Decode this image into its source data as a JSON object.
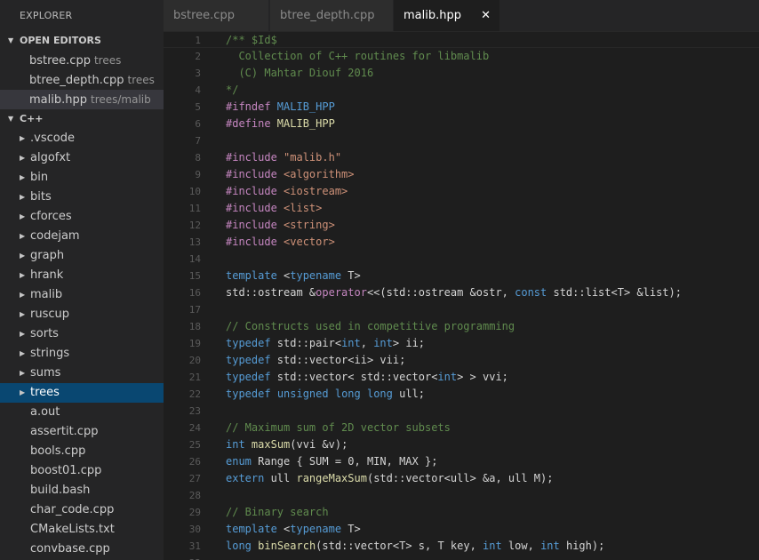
{
  "sidebar": {
    "title": "EXPLORER",
    "open_editors": {
      "header": "OPEN EDITORS",
      "items": [
        {
          "name": "bstree.cpp",
          "desc": "trees"
        },
        {
          "name": "btree_depth.cpp",
          "desc": "trees"
        },
        {
          "name": "malib.hpp",
          "desc": "trees/malib"
        }
      ]
    },
    "workspace": {
      "header": "C++",
      "folders": [
        ".vscode",
        "algofxt",
        "bin",
        "bits",
        "cforces",
        "codejam",
        "graph",
        "hrank",
        "malib",
        "ruscup",
        "sorts",
        "strings",
        "sums",
        "trees"
      ],
      "files": [
        "a.out",
        "assertit.cpp",
        "bools.cpp",
        "boost01.cpp",
        "build.bash",
        "char_code.cpp",
        "CMakeLists.txt",
        "convbase.cpp"
      ]
    }
  },
  "tabs": [
    {
      "label": "bstree.cpp"
    },
    {
      "label": "btree_depth.cpp"
    },
    {
      "label": "malib.hpp",
      "close_glyph": "✕"
    }
  ],
  "editor": {
    "lines": [
      [
        [
          "comment",
          "/** $Id$"
        ]
      ],
      [
        [
          "comment",
          "  Collection of C++ routines for libmalib"
        ]
      ],
      [
        [
          "comment",
          "  (C) Mahtar Diouf 2016"
        ]
      ],
      [
        [
          "comment",
          "*/"
        ]
      ],
      [
        [
          "pp",
          "#ifndef "
        ],
        [
          "macro",
          "MALIB_HPP"
        ]
      ],
      [
        [
          "pp",
          "#define "
        ],
        [
          "fn",
          "MALIB_HPP"
        ]
      ],
      [],
      [
        [
          "pp",
          "#include "
        ],
        [
          "str",
          "\"malib.h\""
        ]
      ],
      [
        [
          "pp",
          "#include "
        ],
        [
          "str",
          "<algorithm>"
        ]
      ],
      [
        [
          "pp",
          "#include "
        ],
        [
          "str",
          "<iostream>"
        ]
      ],
      [
        [
          "pp",
          "#include "
        ],
        [
          "str",
          "<list>"
        ]
      ],
      [
        [
          "pp",
          "#include "
        ],
        [
          "str",
          "<string>"
        ]
      ],
      [
        [
          "pp",
          "#include "
        ],
        [
          "str",
          "<vector>"
        ]
      ],
      [],
      [
        [
          "kw",
          "template"
        ],
        [
          "text",
          " <"
        ],
        [
          "kw",
          "typename"
        ],
        [
          "text",
          " T>"
        ]
      ],
      [
        [
          "text",
          "std::ostream &"
        ],
        [
          "op",
          "operator"
        ],
        [
          "text",
          "<<(std::ostream &ostr, "
        ],
        [
          "kw",
          "const"
        ],
        [
          "text",
          " std::list<T> &list);"
        ]
      ],
      [],
      [
        [
          "comment",
          "// Constructs used in competitive programming"
        ]
      ],
      [
        [
          "kw",
          "typedef"
        ],
        [
          "text",
          " std::pair<"
        ],
        [
          "kw",
          "int"
        ],
        [
          "text",
          ", "
        ],
        [
          "kw",
          "int"
        ],
        [
          "text",
          "> ii;"
        ]
      ],
      [
        [
          "kw",
          "typedef"
        ],
        [
          "text",
          " std::vector<ii> vii;"
        ]
      ],
      [
        [
          "kw",
          "typedef"
        ],
        [
          "text",
          " std::vector< std::vector<"
        ],
        [
          "kw",
          "int"
        ],
        [
          "text",
          "> > vvi;"
        ]
      ],
      [
        [
          "kw",
          "typedef"
        ],
        [
          "text",
          " "
        ],
        [
          "kw",
          "unsigned"
        ],
        [
          "text",
          " "
        ],
        [
          "kw",
          "long"
        ],
        [
          "text",
          " "
        ],
        [
          "kw",
          "long"
        ],
        [
          "text",
          " ull;"
        ]
      ],
      [],
      [
        [
          "comment",
          "// Maximum sum of 2D vector subsets"
        ]
      ],
      [
        [
          "kw",
          "int"
        ],
        [
          "text",
          " "
        ],
        [
          "fn",
          "maxSum"
        ],
        [
          "text",
          "(vvi &v);"
        ]
      ],
      [
        [
          "kw",
          "enum"
        ],
        [
          "text",
          " Range { SUM = 0, MIN, MAX };"
        ]
      ],
      [
        [
          "kw",
          "extern"
        ],
        [
          "text",
          " ull "
        ],
        [
          "fn",
          "rangeMaxSum"
        ],
        [
          "text",
          "(std::vector<ull> &a, ull M);"
        ]
      ],
      [],
      [
        [
          "comment",
          "// Binary search"
        ]
      ],
      [
        [
          "kw",
          "template"
        ],
        [
          "text",
          " <"
        ],
        [
          "kw",
          "typename"
        ],
        [
          "text",
          " T>"
        ]
      ],
      [
        [
          "kw",
          "long"
        ],
        [
          "text",
          " "
        ],
        [
          "fn",
          "binSearch"
        ],
        [
          "text",
          "(std::vector<T> s, T key, "
        ],
        [
          "kw",
          "int"
        ],
        [
          "text",
          " low, "
        ],
        [
          "kw",
          "int"
        ],
        [
          "text",
          " high);"
        ]
      ],
      []
    ]
  }
}
